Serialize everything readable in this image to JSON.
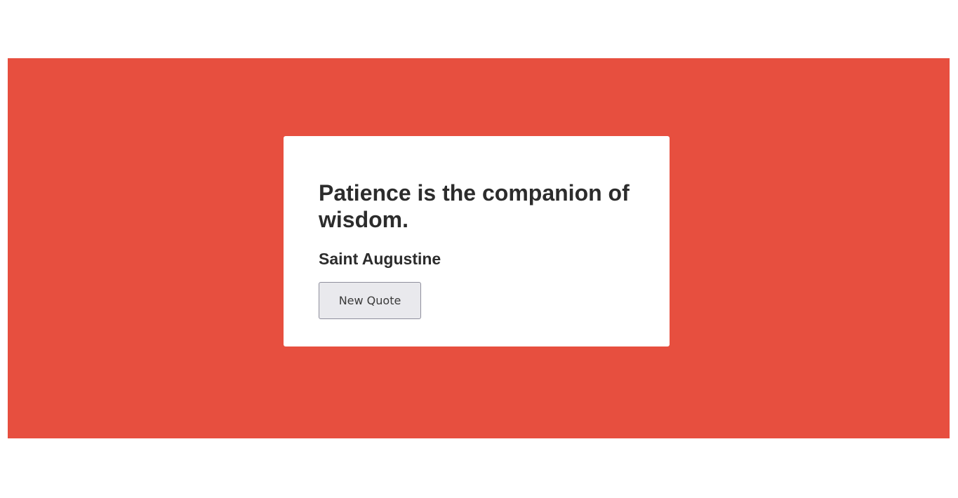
{
  "theme": {
    "background_color": "#e74f3f",
    "card_color": "#ffffff",
    "text_color": "#2c2c2c"
  },
  "quote": {
    "text": "Patience is the companion of wisdom.",
    "author": "Saint Augustine"
  },
  "actions": {
    "new_quote_label": "New Quote"
  }
}
